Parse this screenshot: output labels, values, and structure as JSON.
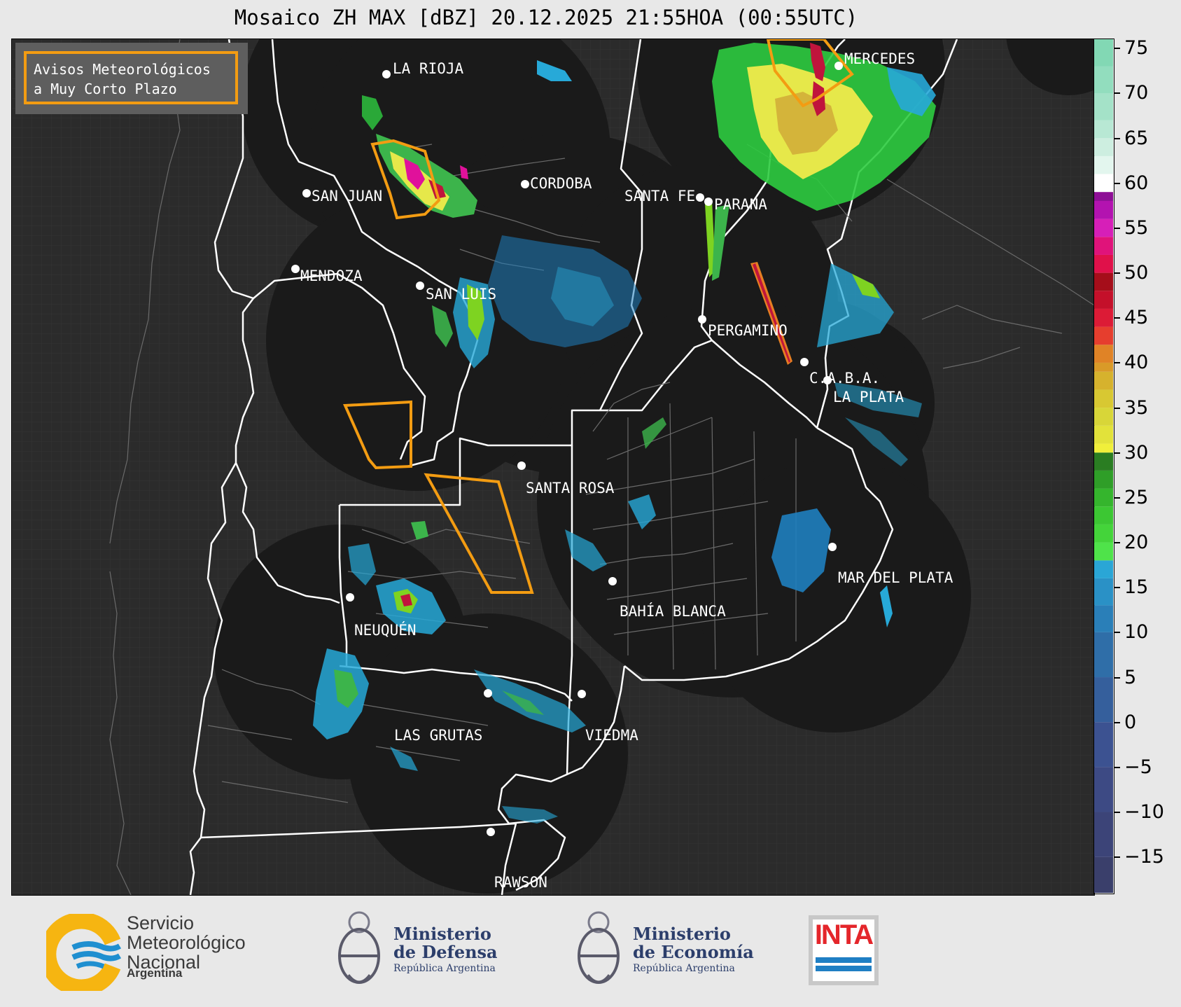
{
  "title": "Mosaico ZH MAX [dBZ] 20.12.2025 21:55HOA (00:55UTC)",
  "legend": {
    "line1": "Avisos Meteorológicos",
    "line2": "a Muy Corto Plazo",
    "border_color": "#f39c12"
  },
  "cities": [
    {
      "name": "LA RIOJA"
    },
    {
      "name": "SAN JUAN"
    },
    {
      "name": "CORDOBA"
    },
    {
      "name": "SANTA FE"
    },
    {
      "name": "PARANA"
    },
    {
      "name": "MERCEDES"
    },
    {
      "name": "MENDOZA"
    },
    {
      "name": "SAN LUIS"
    },
    {
      "name": "PERGAMINO"
    },
    {
      "name": "C.A.B.A."
    },
    {
      "name": "LA PLATA"
    },
    {
      "name": "SANTA ROSA"
    },
    {
      "name": "MAR DEL PLATA"
    },
    {
      "name": "BAHÍA BLANCA"
    },
    {
      "name": "NEUQUÉN"
    },
    {
      "name": "LAS GRUTAS"
    },
    {
      "name": "VIEDMA"
    },
    {
      "name": "RAWSON"
    }
  ],
  "colorbar": {
    "unit": "dBZ",
    "ticks": [
      "75",
      "70",
      "65",
      "60",
      "55",
      "50",
      "45",
      "40",
      "35",
      "30",
      "25",
      "20",
      "15",
      "10",
      "5",
      "0",
      "−5",
      "−10",
      "−15"
    ],
    "range": [
      -19,
      76
    ]
  },
  "footer": {
    "smn_line1": "Servicio",
    "smn_line2": "Meteorológico",
    "smn_line3": "Nacional",
    "smn_country": "Argentina",
    "defensa_line1": "Ministerio",
    "defensa_line2": "de Defensa",
    "defensa_sub": "República Argentina",
    "economia_line1": "Ministerio",
    "economia_line2": "de Economía",
    "economia_sub": "República Argentina",
    "inta": "INTA"
  }
}
